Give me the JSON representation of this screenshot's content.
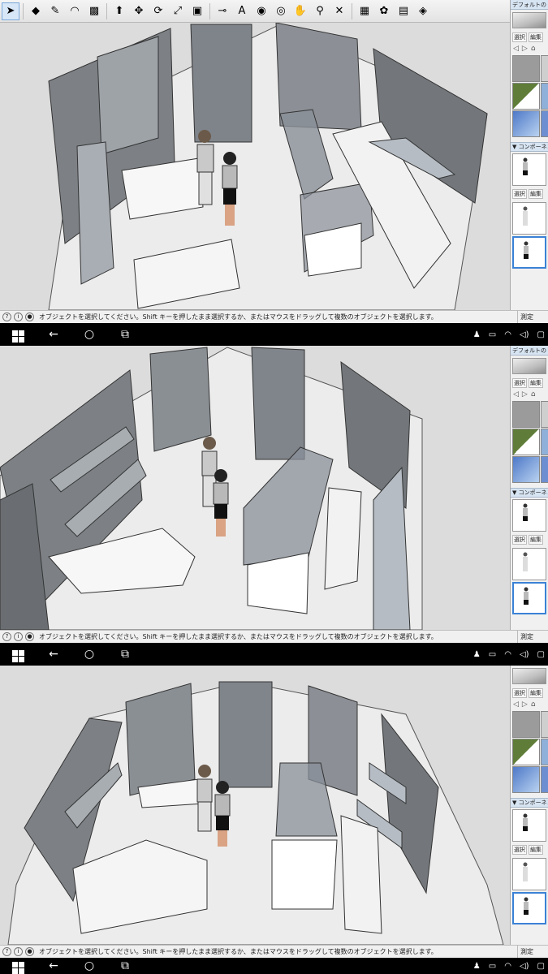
{
  "toolbar": {
    "tools": [
      {
        "name": "select-tool",
        "glyph": "➤"
      },
      {
        "name": "eraser-tool",
        "glyph": "◆"
      },
      {
        "name": "line-tool",
        "glyph": "✎"
      },
      {
        "name": "arc-tool",
        "glyph": "◠"
      },
      {
        "name": "rectangle-tool",
        "glyph": "▩"
      },
      {
        "name": "pushpull-tool",
        "glyph": "⬆"
      },
      {
        "name": "move-tool",
        "glyph": "✥"
      },
      {
        "name": "rotate-tool",
        "glyph": "⟳"
      },
      {
        "name": "scale-tool",
        "glyph": "⤢"
      },
      {
        "name": "offset-tool",
        "glyph": "▣"
      },
      {
        "name": "tape-measure-tool",
        "glyph": "⊸"
      },
      {
        "name": "text-tool",
        "glyph": "A"
      },
      {
        "name": "paint-bucket-tool",
        "glyph": "◉"
      },
      {
        "name": "orbit-tool",
        "glyph": "◎"
      },
      {
        "name": "pan-tool",
        "glyph": "✋"
      },
      {
        "name": "zoom-tool",
        "glyph": "⚲"
      },
      {
        "name": "zoom-extents-tool",
        "glyph": "✕"
      },
      {
        "name": "warehouse-tool",
        "glyph": "▦"
      },
      {
        "name": "extension-tool",
        "glyph": "✿"
      },
      {
        "name": "layout-tool",
        "glyph": "▤"
      },
      {
        "name": "ruby-tool",
        "glyph": "◈"
      }
    ]
  },
  "tray": {
    "style_header": "デフォルトのトレイ",
    "tabs": [
      "選択",
      "編集"
    ],
    "components_header": "▼ コンポーネント"
  },
  "status": {
    "message": "オブジェクトを選択してください。Shift キーを押したまま選択するか、またはマウスをドラッグして複数のオブジェクトを選択します。",
    "measure_label": "測定"
  },
  "colors": {
    "accent": "#3b82d6",
    "wall_dark": "#6f7377",
    "wall_mid": "#9ea2a6",
    "glass": "#8a9099",
    "floor": "#e8e8e8",
    "sky": "#d9d9d9"
  }
}
